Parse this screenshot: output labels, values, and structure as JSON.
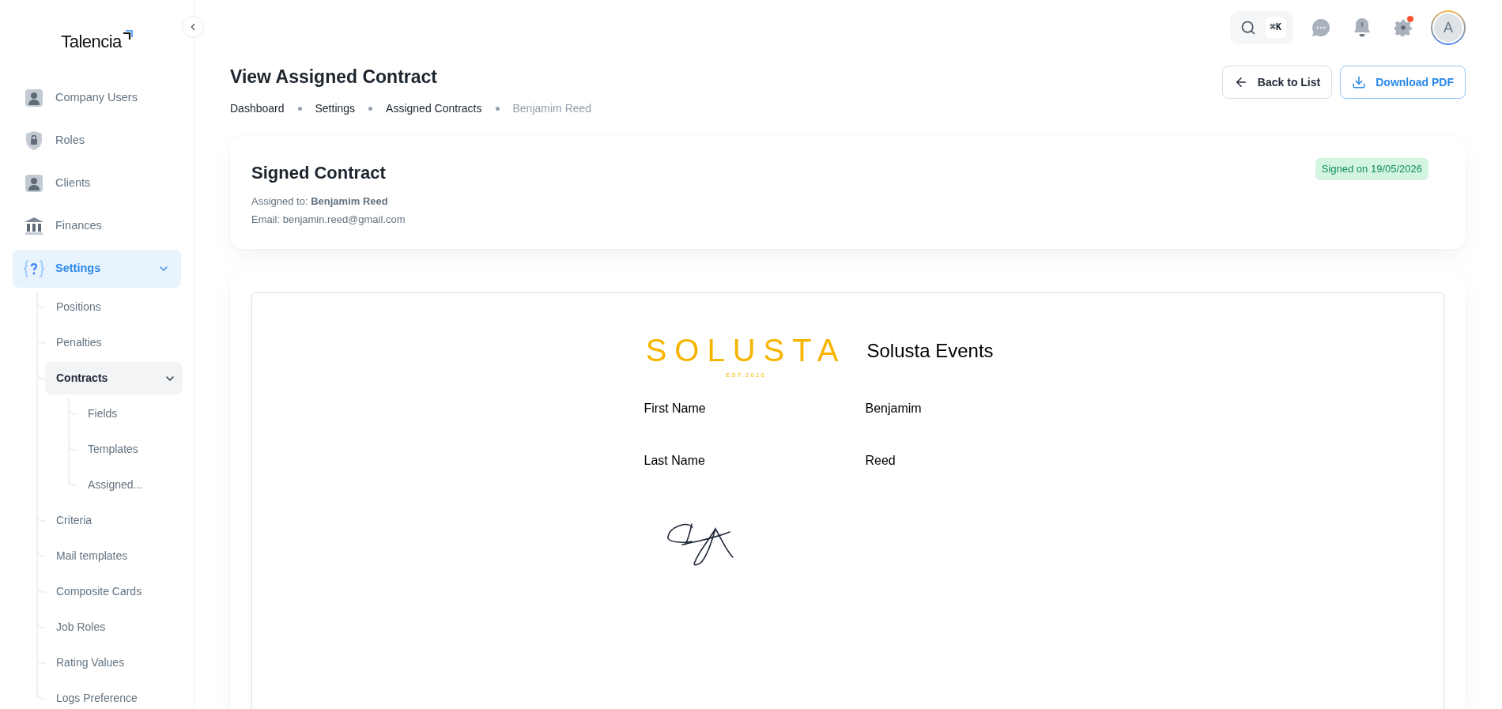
{
  "sidebar": {
    "logo": "Talencia",
    "items": [
      {
        "label": "Company Users",
        "kind": "user",
        "selected": false
      },
      {
        "label": "Roles",
        "kind": "lock",
        "selected": false
      },
      {
        "label": "Clients",
        "kind": "user",
        "selected": false
      },
      {
        "label": "Finances",
        "kind": "bank",
        "selected": false
      },
      {
        "label": "Settings",
        "kind": "braces",
        "selected": true,
        "expanded": true,
        "children": [
          {
            "label": "Positions",
            "selected": false
          },
          {
            "label": "Penalties",
            "selected": false
          },
          {
            "label": "Contracts",
            "selected": true,
            "expanded": true,
            "children": [
              {
                "label": "Fields",
                "selected": false
              },
              {
                "label": "Templates",
                "selected": false
              },
              {
                "label": "Assigned...",
                "selected": false
              }
            ]
          },
          {
            "label": "Criteria",
            "selected": false
          },
          {
            "label": "Mail templates",
            "selected": false
          },
          {
            "label": "Composite Cards",
            "selected": false
          },
          {
            "label": "Job Roles",
            "selected": false
          },
          {
            "label": "Rating Values",
            "selected": false
          },
          {
            "label": "Logs Preference",
            "selected": false
          }
        ]
      }
    ]
  },
  "topbar": {
    "search_shortcut": "⌘K",
    "settings_notification": true,
    "avatar": "A"
  },
  "page": {
    "title": "View Assigned Contract",
    "breadcrumbs": [
      {
        "label": "Dashboard",
        "current": false
      },
      {
        "label": "Settings",
        "current": false
      },
      {
        "label": "Assigned Contracts",
        "current": false
      },
      {
        "label": "Benjamim Reed",
        "current": true
      }
    ],
    "buttons": [
      {
        "label": "Back to List",
        "kind": "back"
      },
      {
        "label": "Download PDF",
        "kind": "download"
      }
    ]
  },
  "summary": {
    "title": "Signed Contract",
    "assigned_label": "Assigned to:",
    "assigned_name": "Benjamim Reed",
    "email": "Email: benjamin.reed@gmail.com",
    "status": "Signed on 19/05/2026"
  },
  "document": {
    "logo": "SOLUSTA",
    "logo_tagline": "EST.2016",
    "company": "Solusta Events",
    "fields": [
      {
        "label": "First Name",
        "value": "Benjamim"
      },
      {
        "label": "Last Name",
        "value": "Reed"
      }
    ]
  }
}
